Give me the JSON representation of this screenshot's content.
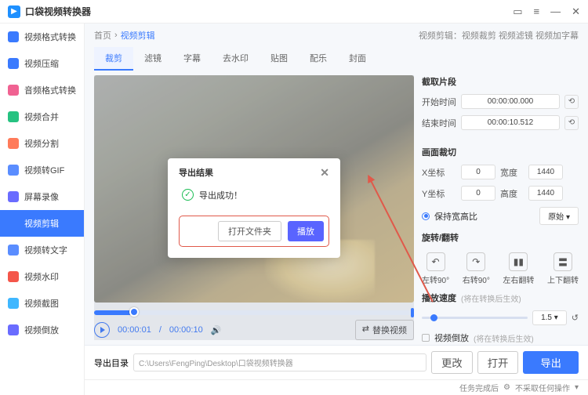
{
  "app": {
    "title": "口袋视频转换器"
  },
  "titlebar": {
    "folder": "▭",
    "menu": "≡",
    "min": "—",
    "close": "✕"
  },
  "sidebar": {
    "items": [
      {
        "label": "视频格式转换",
        "color": "#3a7afe"
      },
      {
        "label": "视频压缩",
        "color": "#3a7afe"
      },
      {
        "label": "音频格式转换",
        "color": "#f06292"
      },
      {
        "label": "视频合并",
        "color": "#26c281"
      },
      {
        "label": "视频分割",
        "color": "#ff7b5a"
      },
      {
        "label": "视频转GIF",
        "color": "#5a8dff"
      },
      {
        "label": "屏幕录像",
        "color": "#6a6cff"
      },
      {
        "label": "视频剪辑",
        "color": "#3a7afe",
        "active": true
      },
      {
        "label": "视频转文字",
        "color": "#5a8dff"
      },
      {
        "label": "视频水印",
        "color": "#f4564a"
      },
      {
        "label": "视频截图",
        "color": "#3fb7ff"
      },
      {
        "label": "视频倒放",
        "color": "#6a6cff"
      }
    ]
  },
  "crumb": {
    "home": "首页",
    "sep": "›",
    "current": "视频剪辑",
    "hint": "视频剪辑：视频裁剪 视频滤镜 视频加字幕"
  },
  "tabs": [
    "裁剪",
    "滤镜",
    "字幕",
    "去水印",
    "贴图",
    "配乐",
    "封面"
  ],
  "player": {
    "cur": "00:00:01",
    "total": "00:00:10",
    "replace": "替换视频",
    "replace_ic": "⇄"
  },
  "panel": {
    "clip_title": "截取片段",
    "start_lbl": "开始时间",
    "start_val": "00:00:00.000",
    "end_lbl": "结束时间",
    "end_val": "00:00:10.512",
    "crop_title": "画面裁切",
    "x_lbl": "X坐标",
    "x_val": "0",
    "w_lbl": "宽度",
    "w_val": "1440",
    "y_lbl": "Y坐标",
    "y_val": "0",
    "h_lbl": "高度",
    "h_val": "1440",
    "keep_ratio": "保持宽高比",
    "ratio_sel": "原始",
    "rotate_title": "旋转/翻转",
    "rot": [
      {
        "ic": "↶",
        "lbl": "左转90°"
      },
      {
        "ic": "↷",
        "lbl": "右转90°"
      },
      {
        "ic": "▮▮",
        "lbl": "左右翻转"
      },
      {
        "ic": "〓",
        "lbl": "上下翻转"
      }
    ],
    "speed_title": "播放速度",
    "speed_hint": "(将在转换后生效)",
    "speed_val": "1.5",
    "reset": "↺",
    "reverse_lbl": "视频倒放",
    "reverse_hint": "(将在转换后生效)"
  },
  "modal": {
    "title": "导出结果",
    "success": "导出成功！",
    "open_folder": "打开文件夹",
    "play": "播放"
  },
  "footer": {
    "out_lbl": "导出目录",
    "out_path": "C:\\Users\\FengPing\\Desktop\\口袋视频转换器",
    "change": "更改",
    "open": "打开",
    "export": "导出"
  },
  "status": {
    "task": "任务完成后",
    "action": "不采取任何操作"
  }
}
